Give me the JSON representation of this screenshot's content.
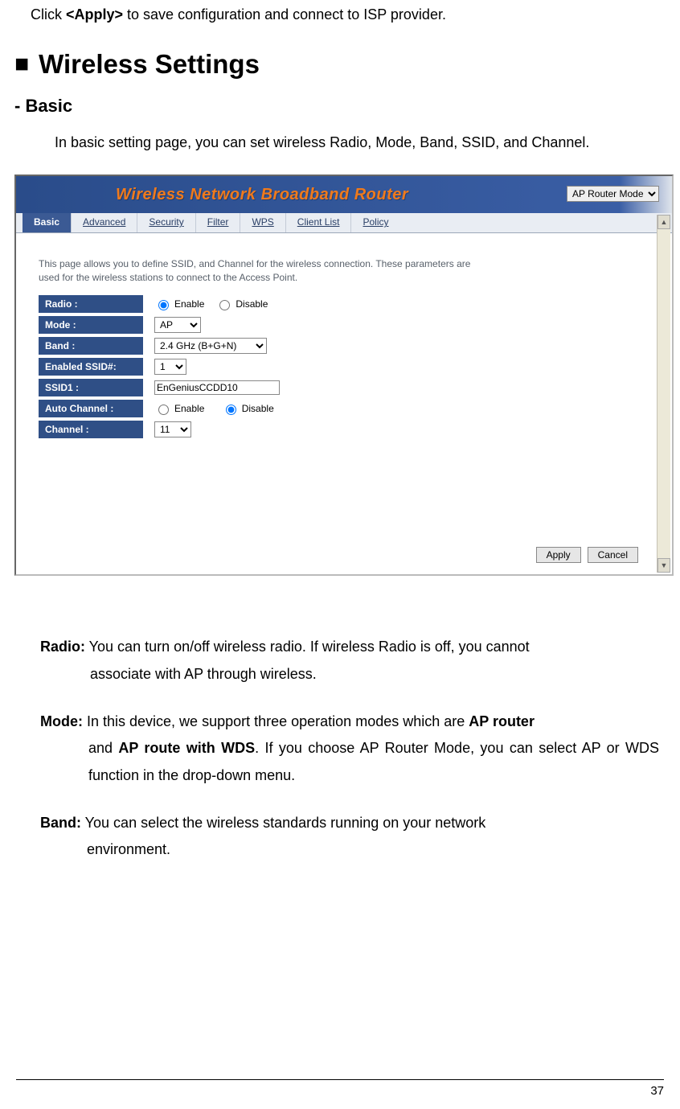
{
  "intro": {
    "prefix": "Click ",
    "bold": "<Apply>",
    "suffix": " to save configuration and connect to ISP provider."
  },
  "section_heading": "Wireless Settings",
  "sub_heading": "- Basic",
  "basic_paragraph": "In basic setting page, you can set wireless Radio, Mode, Band, SSID, and Channel.",
  "router_ui": {
    "header_title": "Wireless Network Broadband Router",
    "mode_dropdown_value": "AP Router Mode",
    "tabs": [
      "Basic",
      "Advanced",
      "Security",
      "Filter",
      "WPS",
      "Client List",
      "Policy"
    ],
    "active_tab_index": 0,
    "description": "This page allows you to define SSID, and Channel for the wireless connection. These parameters are used for the wireless stations to connect to the Access Point.",
    "rows": {
      "radio_label": "Radio :",
      "radio_enable": "Enable",
      "radio_disable": "Disable",
      "mode_label": "Mode :",
      "mode_value": "AP",
      "band_label": "Band :",
      "band_value": "2.4 GHz (B+G+N)",
      "enabled_ssid_label": "Enabled SSID#:",
      "enabled_ssid_value": "1",
      "ssid1_label": "SSID1 :",
      "ssid1_value": "EnGeniusCCDD10",
      "auto_channel_label": "Auto Channel :",
      "auto_channel_enable": "Enable",
      "auto_channel_disable": "Disable",
      "channel_label": "Channel :",
      "channel_value": "11"
    },
    "apply_btn": "Apply",
    "cancel_btn": "Cancel"
  },
  "defs": {
    "radio": {
      "term": "Radio:",
      "line1": " You can turn on/off wireless radio. If wireless Radio is off, you cannot",
      "cont": "associate with AP through wireless."
    },
    "mode": {
      "term": "Mode:",
      "line1": " In this device, we support three operation modes which are ",
      "bold1": "AP router",
      "cont_pre": "and ",
      "bold2": "AP route with WDS",
      "cont_post": ". If you choose AP Router Mode, you can select AP or WDS function in the drop-down menu."
    },
    "band": {
      "term": "Band:",
      "line1": " You can select the wireless standards running on your network",
      "cont": "environment."
    }
  },
  "page_number": "37"
}
